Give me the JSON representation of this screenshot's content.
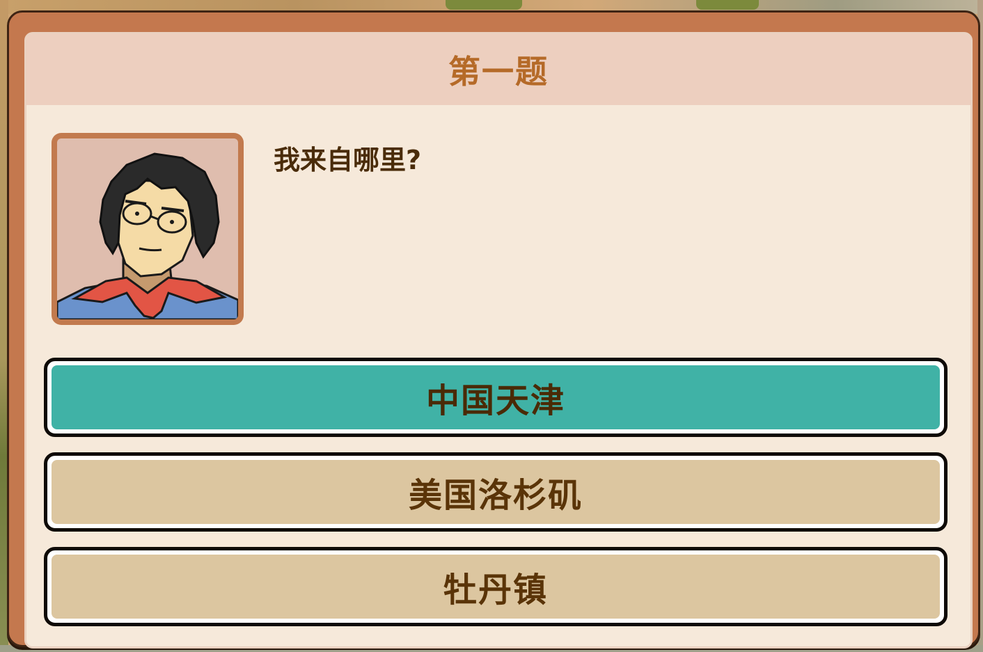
{
  "quiz": {
    "title": "第一题",
    "question": "我来自哪里?",
    "options": [
      {
        "label": "中国天津",
        "selected": true
      },
      {
        "label": "美国洛杉矶",
        "selected": false
      },
      {
        "label": "牡丹镇",
        "selected": false
      }
    ]
  },
  "colors": {
    "frame": "#c4784e",
    "panel": "#f6e9da",
    "title_bar": "#edcfbf",
    "title_text": "#b56a28",
    "option_selected": "#40b2a6",
    "option_normal": "#dcc6a0",
    "option_text": "#5a3408"
  },
  "portrait": {
    "icon": "character-portrait"
  }
}
